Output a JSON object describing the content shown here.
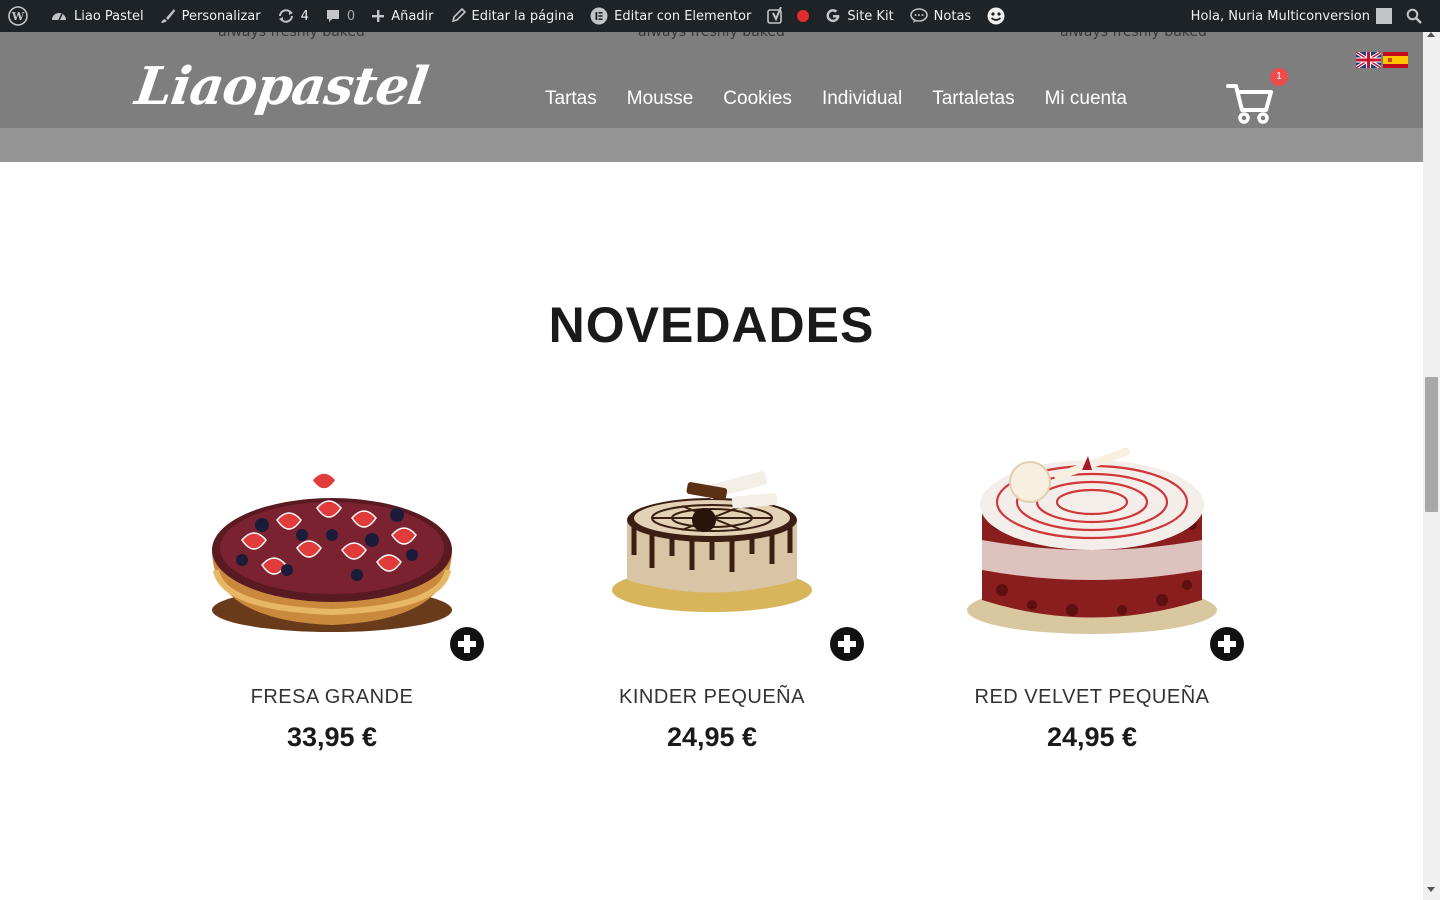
{
  "adminbar": {
    "items": [
      {
        "label": "",
        "icon": "wordpress-icon"
      },
      {
        "label": "Liao Pastel",
        "icon": "dashboard-icon"
      },
      {
        "label": "Personalizar",
        "icon": "brush-icon"
      },
      {
        "label": "4",
        "icon": "updates-icon"
      },
      {
        "label": "0",
        "icon": "comments-icon"
      },
      {
        "label": "Añadir",
        "icon": "plus-icon"
      },
      {
        "label": "Editar la página",
        "icon": "pencil-icon"
      },
      {
        "label": "Editar con Elementor",
        "icon": "elementor-icon"
      },
      {
        "label": "",
        "icon": "yoast-icon"
      },
      {
        "label": "Site Kit",
        "icon": "google-icon"
      },
      {
        "label": "Notas",
        "icon": "notes-icon"
      }
    ],
    "greeting": "Hola, Nuria Multiconversion"
  },
  "header": {
    "logo_text": "Liaopastel",
    "nav": [
      "Tartas",
      "Mousse",
      "Cookies",
      "Individual",
      "Tartaletas",
      "Mi cuenta"
    ],
    "cart_count": "1",
    "ghost_text": "always freshly baked"
  },
  "section": {
    "title": "NOVEDADES"
  },
  "products": [
    {
      "name": "FRESA GRANDE",
      "price": "33,95 €"
    },
    {
      "name": "KINDER PEQUEÑA",
      "price": "24,95 €"
    },
    {
      "name": "RED VELVET PEQUEÑA",
      "price": "24,95 €"
    }
  ],
  "colors": {
    "adminbar_bg": "#1d2327",
    "header_bg": "#7e7e7e",
    "badge_red": "#ef4b4b"
  }
}
